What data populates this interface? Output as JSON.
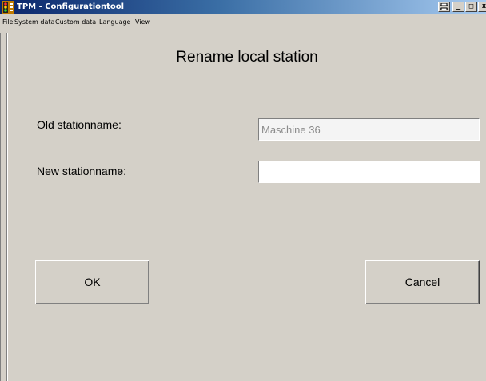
{
  "window": {
    "title": "TPM - Configurationtool",
    "controls": {
      "print_icon": "printer-icon",
      "minimize": "_",
      "maximize": "□",
      "close": "x"
    }
  },
  "menubar": {
    "items": [
      {
        "label": "File"
      },
      {
        "label": "System data"
      },
      {
        "label": "Custom data"
      },
      {
        "label": "Language"
      },
      {
        "label": "View"
      }
    ]
  },
  "dialog": {
    "title": "Rename local station",
    "old_label": "Old stationname:",
    "old_value": "Maschine 36",
    "new_label": "New stationname:",
    "new_value": "",
    "ok_label": "OK",
    "cancel_label": "Cancel"
  },
  "colors": {
    "titlebar_start": "#0a246a",
    "titlebar_end": "#a6caf0",
    "face": "#d4d0c8"
  }
}
